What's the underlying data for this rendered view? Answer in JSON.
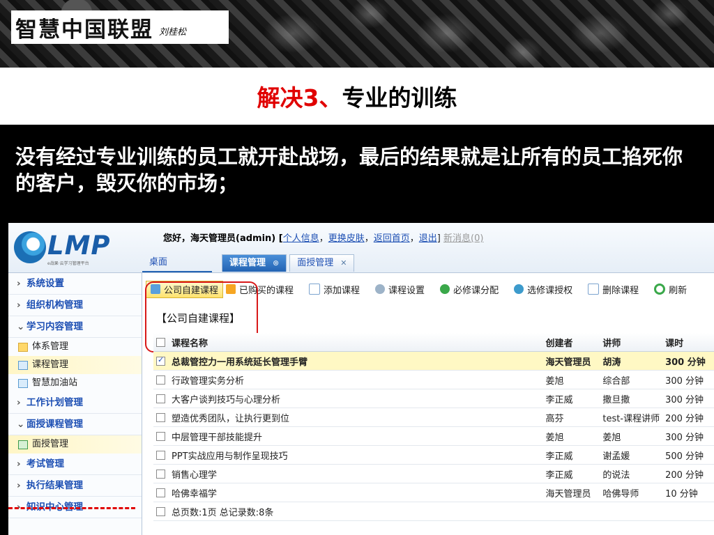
{
  "slide": {
    "logo_text": "智慧中国联盟",
    "logo_author": "刘桂松",
    "title_red": "解决3、",
    "title_black": "专业的训练",
    "subtitle": "没有经过专业训练的员工就开赴战场，最后的结果就是让所有的员工掐死你的客户，毁灭你的市场；"
  },
  "app": {
    "logo": "LMP",
    "logo_tag": "e战果·云学习管理平台",
    "greeting": {
      "prefix": "您好，海天管理员(admin) [",
      "links": [
        "个人信息",
        "更换皮肤",
        "返回首页",
        "退出"
      ],
      "suffix": "]",
      "new_msg": "新消息(0)"
    },
    "tabs": [
      {
        "label": "桌面",
        "active": false
      },
      {
        "label": "课程管理",
        "active": true
      },
      {
        "label": "面授管理",
        "active": false
      }
    ],
    "sidebar": {
      "groups": [
        {
          "label": "系统设置",
          "arrow": "›"
        },
        {
          "label": "组织机构管理",
          "arrow": "›"
        },
        {
          "label": "学习内容管理",
          "arrow": "⌄"
        },
        {
          "label": "工作计划管理",
          "arrow": "›"
        },
        {
          "label": "面授课程管理",
          "arrow": "⌄"
        },
        {
          "label": "考试管理",
          "arrow": "›"
        },
        {
          "label": "执行结果管理",
          "arrow": "›"
        },
        {
          "label": "知识中心管理",
          "arrow": "›"
        }
      ],
      "subs": [
        "体系管理",
        "课程管理",
        "智慧加油站",
        "面授管理"
      ]
    },
    "toolbar": [
      "公司自建课程",
      "已购买的课程",
      "添加课程",
      "课程设置",
      "必修课分配",
      "选修课授权",
      "删除课程",
      "刷新"
    ],
    "section_title": "【公司自建课程】",
    "table": {
      "headers": [
        "课程名称",
        "创建者",
        "讲师",
        "课时"
      ],
      "rows": [
        [
          "总裁管控力一用系统延长管理手臂",
          "海天管理员",
          "胡涛",
          "300 分钟"
        ],
        [
          "行政管理实务分析",
          "姜旭",
          "综合部",
          "300 分钟"
        ],
        [
          "大客户谈判技巧与心理分析",
          "李正威",
          "撒旦撒",
          "300 分钟"
        ],
        [
          "塑造优秀团队，让执行更到位",
          "高芬",
          "test-课程讲师",
          "200 分钟"
        ],
        [
          "中层管理干部技能提升",
          "姜旭",
          "姜旭",
          "300 分钟"
        ],
        [
          "PPT实战应用与制作呈现技巧",
          "李正威",
          "谢孟媛",
          "500 分钟"
        ],
        [
          "销售心理学",
          "李正威",
          "的说法",
          "200 分钟"
        ],
        [
          "哈佛幸福学",
          "海天管理员",
          "哈佛导师",
          "10 分钟"
        ]
      ],
      "footer": "总页数:1页 总记录数:8条"
    }
  }
}
